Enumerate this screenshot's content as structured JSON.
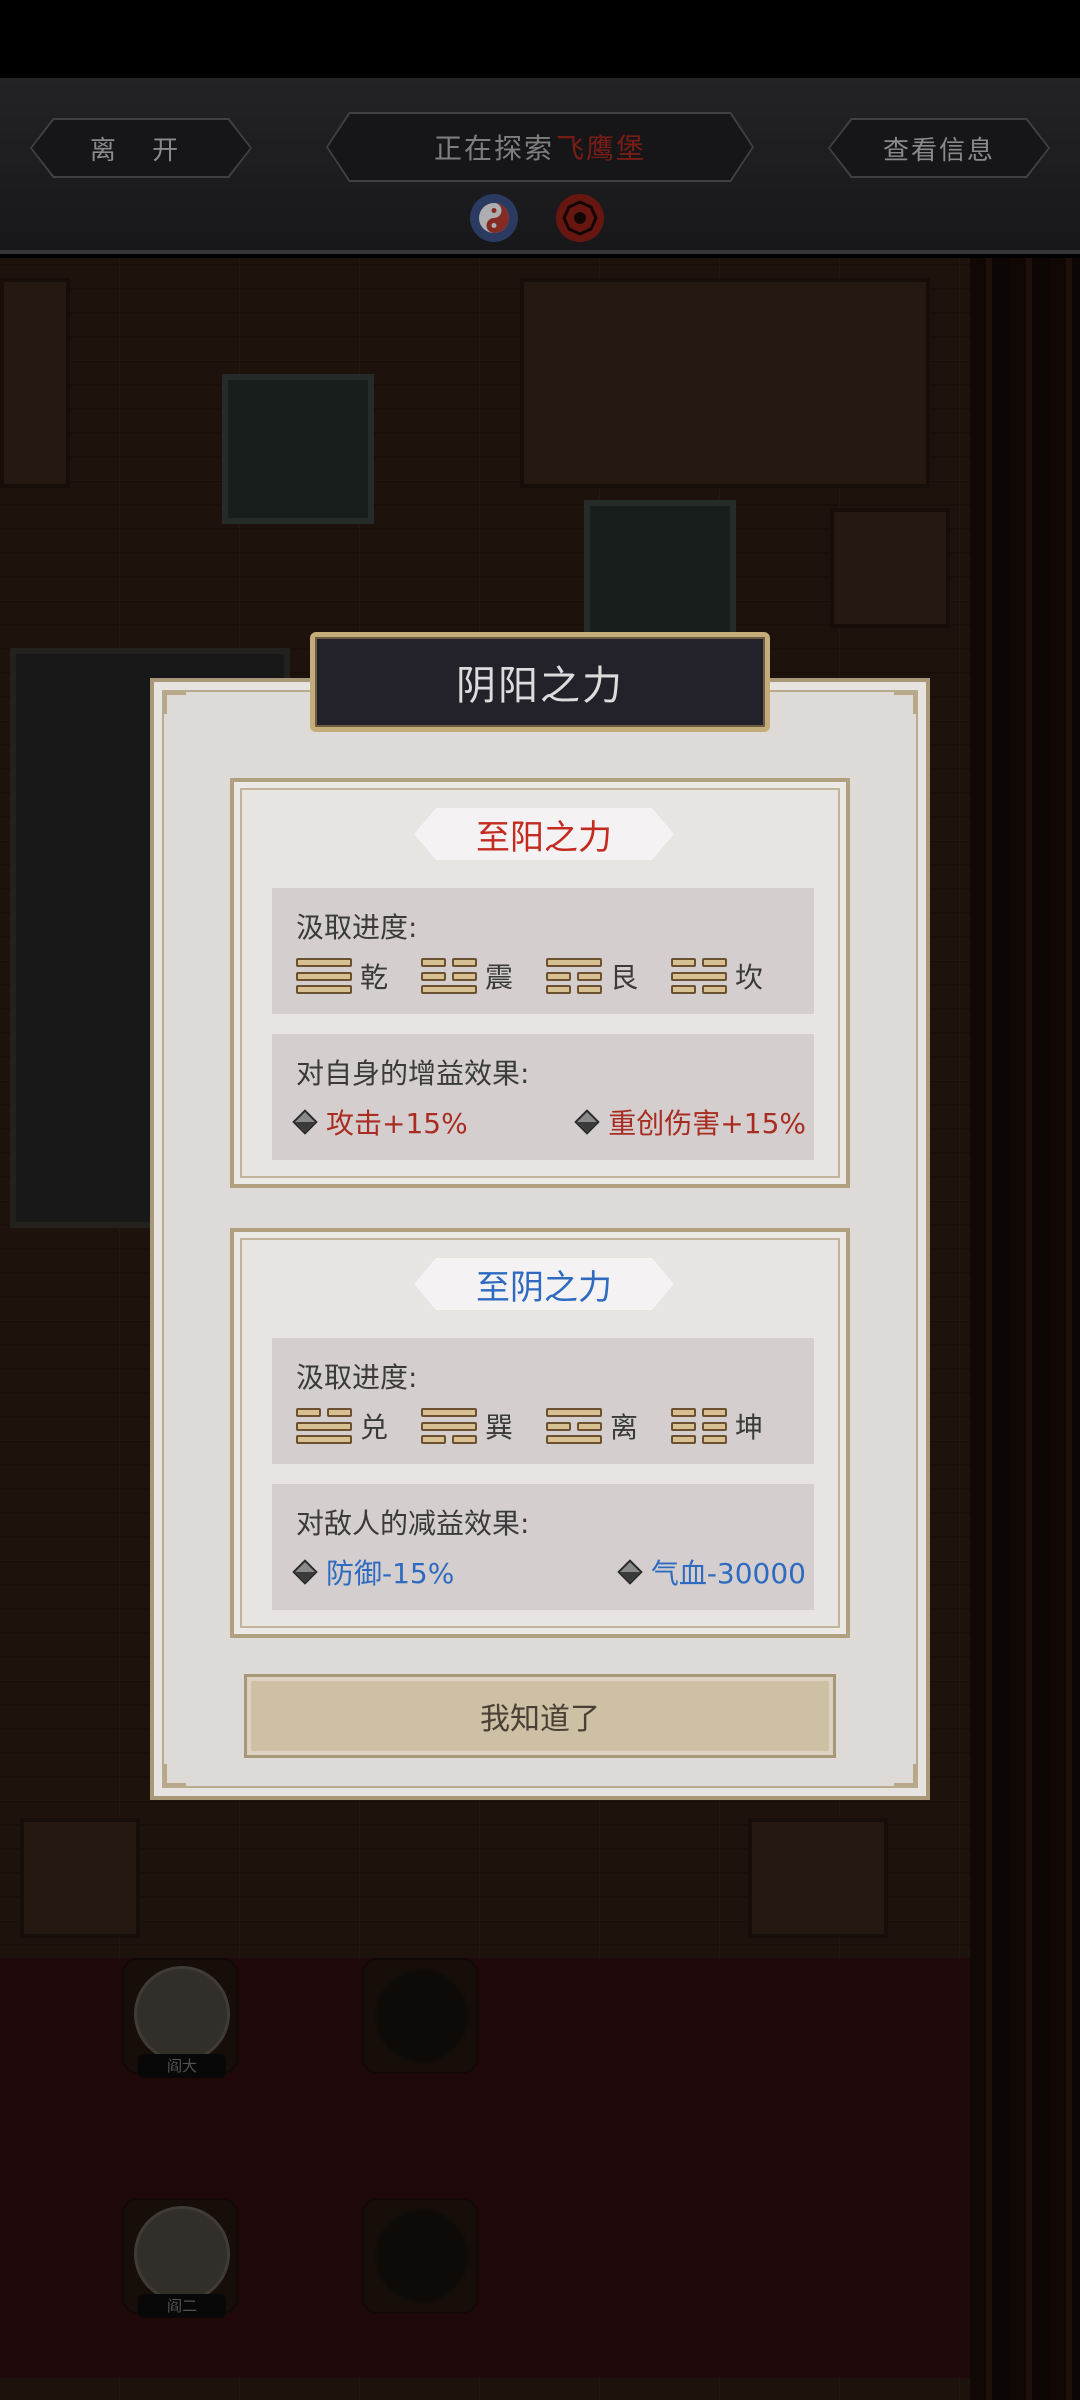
{
  "header": {
    "leave_label": "离 开",
    "exploring_label": "正在探索",
    "location": "飞鹰堡",
    "info_label": "查看信息"
  },
  "icons": {
    "yinyang": "yin-yang-icon",
    "bagua": "bagua-icon"
  },
  "map": {
    "characters": [
      {
        "name": "阎大"
      },
      {
        "name": "阎二"
      }
    ]
  },
  "modal": {
    "title": "阴阳之力",
    "yang": {
      "label": "至阳之力",
      "progress_heading": "汲取进度:",
      "trigrams": [
        {
          "name": "乾"
        },
        {
          "name": "震"
        },
        {
          "name": "艮"
        },
        {
          "name": "坎"
        }
      ],
      "effect_heading": "对自身的增益效果:",
      "effects": [
        "攻击+15%",
        "重创伤害+15%"
      ]
    },
    "yin": {
      "label": "至阴之力",
      "progress_heading": "汲取进度:",
      "trigrams": [
        {
          "name": "兑"
        },
        {
          "name": "巽"
        },
        {
          "name": "离"
        },
        {
          "name": "坤"
        }
      ],
      "effect_heading": "对敌人的减益效果:",
      "effects": [
        "防御-15%",
        "气血-30000"
      ]
    },
    "confirm_label": "我知道了"
  },
  "colors": {
    "yang": "#c32a20",
    "yin": "#2e6bc0",
    "modal_bg": "#dedad8",
    "title_bg": "#23222a"
  }
}
